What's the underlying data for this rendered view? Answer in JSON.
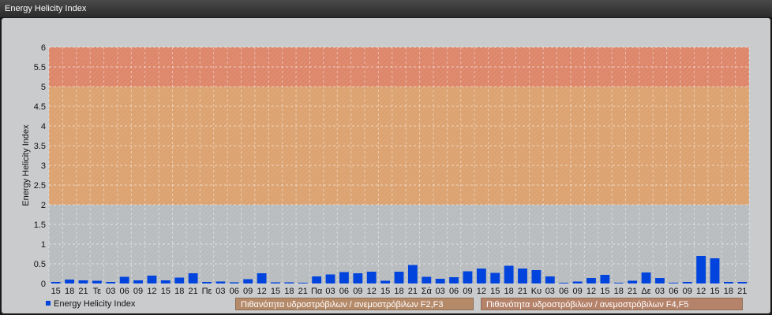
{
  "window": {
    "title": "Energy Helicity Index"
  },
  "chart_data": {
    "type": "bar",
    "ylabel": "Energy Helicity Index",
    "ylim": [
      0,
      6
    ],
    "yticks": [
      "0",
      "0.5",
      "1",
      "1.5",
      "2",
      "2.5",
      "3",
      "3.5",
      "4",
      "4.5",
      "5",
      "5.5",
      "6"
    ],
    "grid": true,
    "categories": [
      "15",
      "18",
      "21",
      "Τε",
      "03",
      "06",
      "09",
      "12",
      "15",
      "18",
      "21",
      "Πε",
      "03",
      "06",
      "09",
      "12",
      "15",
      "18",
      "21",
      "Πα",
      "03",
      "06",
      "09",
      "12",
      "15",
      "18",
      "21",
      "Σά",
      "03",
      "06",
      "09",
      "12",
      "15",
      "18",
      "21",
      "Κυ",
      "03",
      "06",
      "09",
      "12",
      "15",
      "18",
      "21",
      "Δε",
      "03",
      "06",
      "09",
      "12",
      "15",
      "18",
      "21"
    ],
    "series": [
      {
        "name": "Energy Helicity Index",
        "color": "#0044dd",
        "values": [
          0.04,
          0.1,
          0.08,
          0.07,
          0.04,
          0.17,
          0.08,
          0.2,
          0.08,
          0.15,
          0.26,
          0.04,
          0.05,
          0.03,
          0.11,
          0.26,
          0.03,
          0.03,
          0.02,
          0.18,
          0.23,
          0.29,
          0.26,
          0.3,
          0.07,
          0.3,
          0.47,
          0.17,
          0.12,
          0.16,
          0.31,
          0.38,
          0.27,
          0.45,
          0.38,
          0.34,
          0.18,
          0.02,
          0.05,
          0.14,
          0.22,
          0.02,
          0.07,
          0.28,
          0.14,
          0.02,
          0.04,
          0.7,
          0.64,
          0.04,
          0.04
        ]
      }
    ],
    "bands": [
      {
        "from": 2,
        "to": 5,
        "color": "#dca270",
        "label": "Πιθανότητα υδροστρόβιλων / ανεμοστρόβιλων F2,F3"
      },
      {
        "from": 5,
        "to": 6,
        "color": "#dd866a",
        "label": "Πιθανότητα υδροστρόβιλων / ανεμοστρόβιλων F4,F5"
      }
    ],
    "legend_position": "bottom"
  }
}
